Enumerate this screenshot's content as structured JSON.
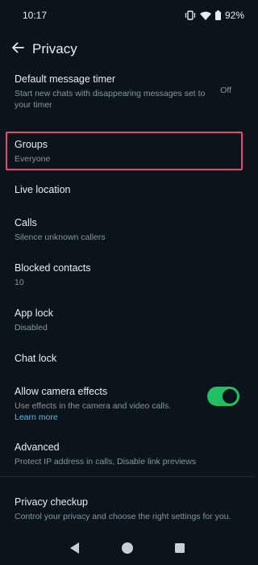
{
  "status_bar": {
    "time": "10:17",
    "battery": "92%",
    "icons": [
      "vibrate-icon",
      "wifi-icon",
      "battery-icon"
    ]
  },
  "header": {
    "title": "Privacy",
    "back_icon": "arrow-left-icon"
  },
  "items": {
    "message_timer": {
      "title": "Default message timer",
      "subtitle": "Start new chats with disappearing messages set to your timer",
      "value": "Off"
    },
    "groups": {
      "title": "Groups",
      "subtitle": "Everyone"
    },
    "live_location": {
      "title": "Live location"
    },
    "calls": {
      "title": "Calls",
      "subtitle": "Silence unknown callers"
    },
    "blocked": {
      "title": "Blocked contacts",
      "subtitle": "10"
    },
    "app_lock": {
      "title": "App lock",
      "subtitle": "Disabled"
    },
    "chat_lock": {
      "title": "Chat lock"
    },
    "camera_effects": {
      "title": "Allow camera effects",
      "subtitle": "Use effects in the camera and video calls.",
      "link": "Learn more",
      "enabled": true
    },
    "advanced": {
      "title": "Advanced",
      "subtitle": "Protect IP address in calls, Disable link previews"
    },
    "checkup": {
      "title": "Privacy checkup",
      "subtitle": "Control your privacy and choose the right settings for you."
    }
  },
  "colors": {
    "background": "#0b141a",
    "accent_green": "#21c063",
    "link_blue": "#53bdeb",
    "highlight_border": "#e8466c"
  },
  "nav_bar": {
    "icons": [
      "back-triangle-icon",
      "home-circle-icon",
      "recents-square-icon"
    ]
  }
}
